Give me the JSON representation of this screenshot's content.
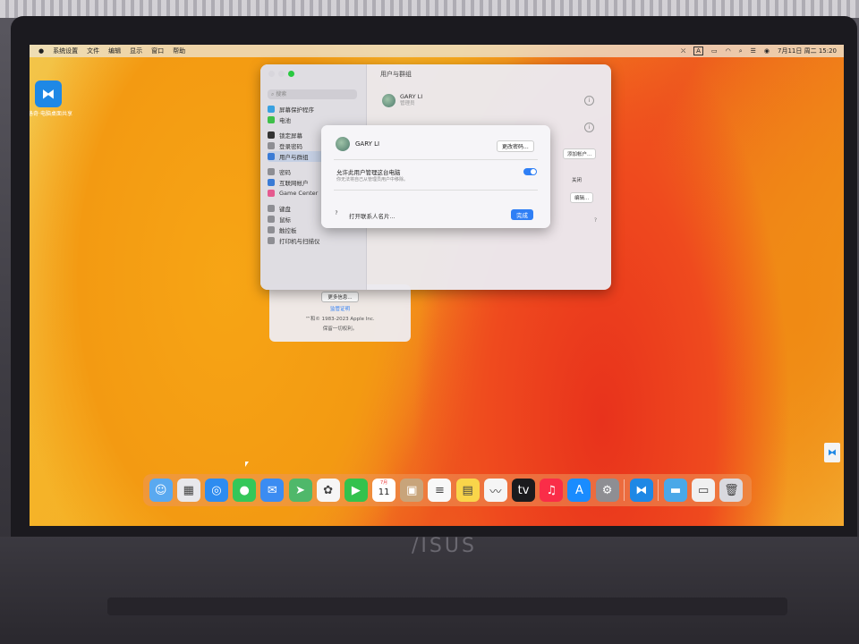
{
  "menubar": {
    "apple": "",
    "items": [
      "系统设置",
      "文件",
      "编辑",
      "显示",
      "窗口",
      "帮助"
    ],
    "status": {
      "input": "A",
      "datetime": "7月11日 周二 15:20"
    }
  },
  "desktop": {
    "icon_label": "洛奇·电脑桌面共享"
  },
  "about_window": {
    "button": "更多信息...",
    "line1": "监管证明",
    "line2": "™和© 1983-2023 Apple Inc.",
    "line3": "保留一切权利。"
  },
  "settings": {
    "search_placeholder": "搜索",
    "pane_title": "用户与群组",
    "sidebar": [
      {
        "label": "屏幕保护程序",
        "color": "#3aa1e0"
      },
      {
        "label": "电池",
        "color": "#3fbf4a"
      },
      {
        "label": "锁定屏幕",
        "color": "#333333"
      },
      {
        "label": "登录密码",
        "color": "#8e8e93"
      },
      {
        "label": "用户与群组",
        "color": "#3a7bd5"
      },
      {
        "label": "密码",
        "color": "#8e8e93"
      },
      {
        "label": "互联网帐户",
        "color": "#3a7bd5"
      },
      {
        "label": "Game Center",
        "color": "#e55a8f"
      },
      {
        "label": "键盘",
        "color": "#8e8e93"
      },
      {
        "label": "鼠标",
        "color": "#8e8e93"
      },
      {
        "label": "触控板",
        "color": "#8e8e93"
      },
      {
        "label": "打印机与扫描仪",
        "color": "#8e8e93"
      }
    ],
    "user_name": "GARY LI",
    "user_role": "管理员",
    "add_account": "添加帐户...",
    "off_label": "关闭",
    "edit_label": "编辑...",
    "help": "?"
  },
  "sheet": {
    "name": "GARY LI",
    "change_password": "更改密码...",
    "allow_admin": "允许此用户管理这台电脑",
    "allow_sub": "你无法将自己从管理员用户中移除。",
    "toggle_on": true,
    "help": "?",
    "open_contact": "打开联系人名片...",
    "done": "完成"
  },
  "dock": {
    "apps": [
      {
        "name": "finder-icon",
        "color": "#5aa9f0",
        "glyph": "☺"
      },
      {
        "name": "launchpad-icon",
        "color": "#e8e8ec",
        "glyph": "▦"
      },
      {
        "name": "safari-icon",
        "color": "#2d8cf0",
        "glyph": "◎"
      },
      {
        "name": "messages-icon",
        "color": "#34c759",
        "glyph": "●"
      },
      {
        "name": "mail-icon",
        "color": "#3b8cf2",
        "glyph": "✉"
      },
      {
        "name": "maps-icon",
        "color": "#4fb86a",
        "glyph": "➤"
      },
      {
        "name": "photos-icon",
        "color": "#f6f6f6",
        "glyph": "✿"
      },
      {
        "name": "facetime-icon",
        "color": "#33c24d",
        "glyph": "▶"
      },
      {
        "name": "calendar-icon",
        "color": "#ffffff",
        "glyph": "11"
      },
      {
        "name": "contacts-icon",
        "color": "#c8a47a",
        "glyph": "▣"
      },
      {
        "name": "reminders-icon",
        "color": "#f8f8f8",
        "glyph": "≡"
      },
      {
        "name": "notes-icon",
        "color": "#f9d54a",
        "glyph": "▤"
      },
      {
        "name": "freeform-icon",
        "color": "#f5f5f5",
        "glyph": "〰"
      },
      {
        "name": "apple-tv-icon",
        "color": "#1b1b1d",
        "glyph": "tv"
      },
      {
        "name": "music-icon",
        "color": "#fa2d48",
        "glyph": "♫"
      },
      {
        "name": "app-store-icon",
        "color": "#1a8cff",
        "glyph": "A"
      },
      {
        "name": "system-settings-icon",
        "color": "#8e8e93",
        "glyph": "⚙"
      },
      {
        "name": "remote-desktop-icon",
        "color": "#1e88e5",
        "glyph": "⧓"
      },
      {
        "name": "downloads-folder-icon",
        "color": "#4aa8e8",
        "glyph": "▬"
      },
      {
        "name": "documents-icon",
        "color": "#f0f0f0",
        "glyph": "▭"
      },
      {
        "name": "trash-icon",
        "color": "#d9d9de",
        "glyph": "🗑"
      }
    ],
    "calendar_month": "7月"
  },
  "laptop": {
    "brand": "/ISUS"
  }
}
